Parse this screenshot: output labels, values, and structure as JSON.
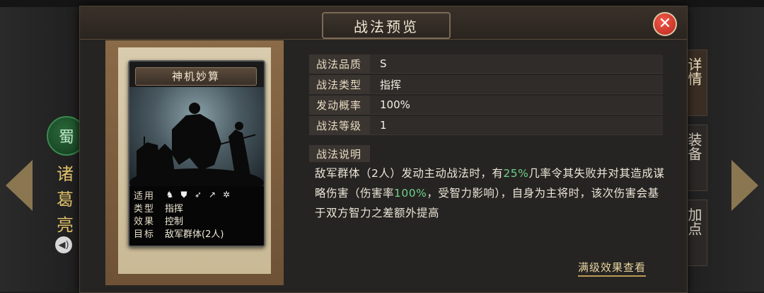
{
  "dialog": {
    "title": "战法预览",
    "close_label": "✕"
  },
  "card": {
    "name": "神机妙算",
    "info": [
      {
        "key": "适用",
        "value": ""
      },
      {
        "key": "类型",
        "value": "指挥"
      },
      {
        "key": "效果",
        "value": "控制"
      },
      {
        "key": "目标",
        "value": "敌军群体(2人)"
      }
    ],
    "unit_icons": [
      "cavalry-icon",
      "shield-icon",
      "bow-icon",
      "spear-icon",
      "wheel-icon"
    ]
  },
  "stats": [
    {
      "label": "战法品质",
      "value": "S"
    },
    {
      "label": "战法类型",
      "value": "指挥"
    },
    {
      "label": "发动概率",
      "value": "100%"
    },
    {
      "label": "战法等级",
      "value": "1"
    }
  ],
  "description": {
    "label": "战法说明",
    "part1": "敌军群体（2人）发动主动战法时，有",
    "rate": "25%",
    "part2": "几率令其失败并对其造成谋略伤害（伤害率",
    "damage": "100%",
    "part3": "，受智力影响），自身为主将时，该次伤害会基于双方智力之差额外提高"
  },
  "full_effect_link": "满级效果查看",
  "hero": {
    "faction": "蜀",
    "name_chars": [
      "诸",
      "葛",
      "亮"
    ]
  },
  "side_tabs": [
    "详情",
    "装备",
    "加点"
  ],
  "colors": {
    "highlight": "#6fd08a",
    "close": "#d83a2c",
    "accent_gold": "#e0c06a"
  }
}
